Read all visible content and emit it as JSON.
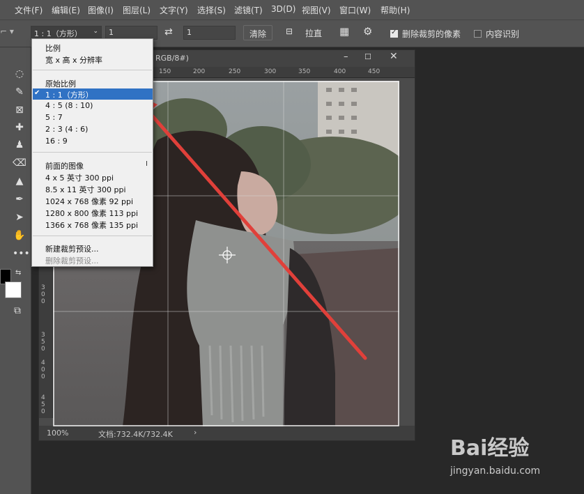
{
  "menubar": {
    "items": [
      "文件(F)",
      "编辑(E)",
      "图像(I)",
      "图层(L)",
      "文字(Y)",
      "选择(S)",
      "滤镜(T)",
      "3D(D)",
      "视图(V)",
      "窗口(W)",
      "帮助(H)"
    ]
  },
  "options": {
    "ratio_select": "1 : 1（方形）",
    "width_value": "1",
    "height_value": "1",
    "clear_label": "清除",
    "straighten_label": "拉直",
    "delete_cropped_label": "删除裁剪的像素",
    "delete_cropped_checked": true,
    "content_aware_label": "内容识别",
    "content_aware_checked": false
  },
  "dropdown": {
    "group1": [
      "比例",
      "宽 x 高 x 分辨率"
    ],
    "original_ratio": "原始比例",
    "ratios": [
      "1 : 1（方形）",
      "4 : 5 (8 : 10)",
      "5 : 7",
      "2 : 3 (4 : 6)",
      "16 : 9"
    ],
    "selected_index": 0,
    "front_image": "前面的图像",
    "presets": [
      "4 x 5 英寸 300 ppi",
      "8.5 x 11 英寸 300 ppi",
      "1024 x 768 像素 92 ppi",
      "1280 x 800 像素 113 ppi",
      "1366 x 768 像素 135 ppi"
    ],
    "new_preset": "新建裁剪预设...",
    "delete_preset": "删除裁剪预设..."
  },
  "document": {
    "title_fragment": "RGB/8#)",
    "ruler_top_labels": [
      "150",
      "200",
      "250",
      "300",
      "350",
      "400",
      "450"
    ],
    "ruler_left_labels": [
      "300",
      "350",
      "400",
      "450"
    ],
    "zoom": "100%",
    "doc_info": "文档:732.4K/732.4K"
  },
  "watermark": {
    "brand": "Bai经验",
    "url": "jingyan.baidu.com"
  },
  "colors": {
    "accent_selected": "#3072c4",
    "arrow": "#e0403a",
    "panel_bg": "#535353"
  }
}
